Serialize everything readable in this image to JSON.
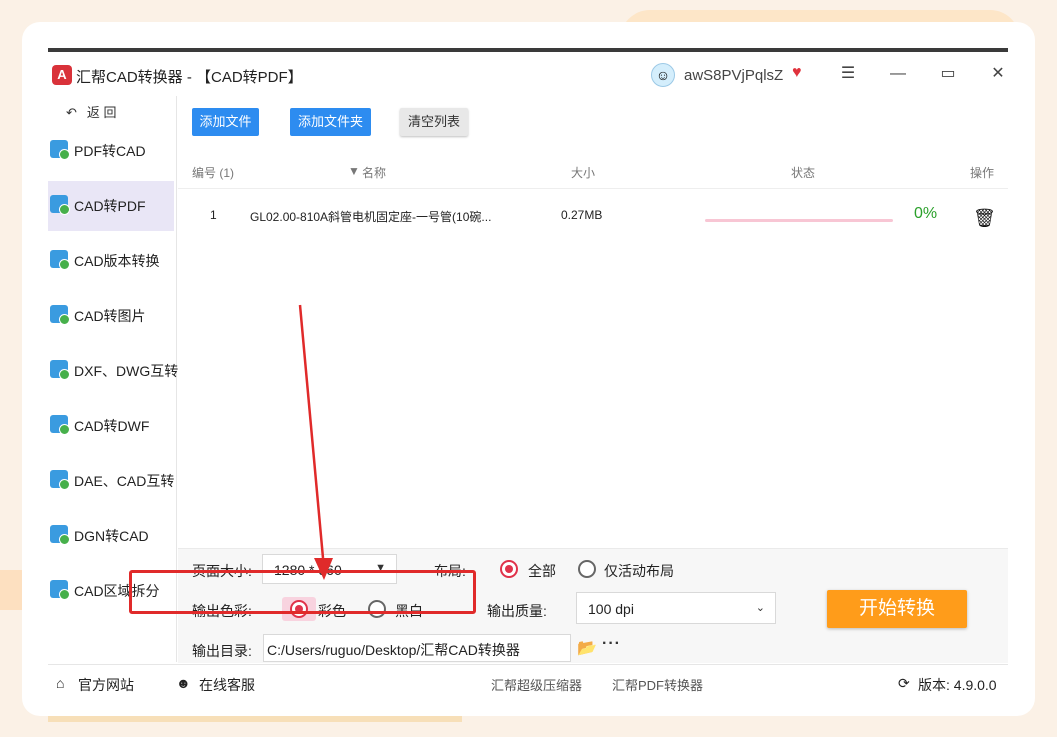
{
  "window": {
    "title": "汇帮CAD转换器 - 【CAD转PDF】",
    "username": "awS8PVjPqlsZ",
    "logo_letter": "A"
  },
  "sidebar": {
    "back_label": "返 回",
    "items": [
      {
        "label": "PDF转CAD"
      },
      {
        "label": "CAD转PDF",
        "active": true
      },
      {
        "label": "CAD版本转换"
      },
      {
        "label": "CAD转图片"
      },
      {
        "label": "DXF、DWG互转"
      },
      {
        "label": "CAD转DWF"
      },
      {
        "label": "DAE、CAD互转"
      },
      {
        "label": "DGN转CAD"
      },
      {
        "label": "CAD区域拆分"
      }
    ]
  },
  "toolbar": {
    "add_file": "添加文件",
    "add_folder": "添加文件夹",
    "clear_list": "清空列表"
  },
  "table": {
    "headers": {
      "index": "编号 (1)",
      "name": "名称",
      "size": "大小",
      "status": "状态",
      "action": "操作"
    },
    "rows": [
      {
        "index": "1",
        "name": "GL02.00-810A斜管电机固定座-一号管(10碗...",
        "size": "0.27MB",
        "progress_pct": 0,
        "status": "0%"
      }
    ]
  },
  "settings": {
    "page_size_label": "页面大小:",
    "page_size_value": "1280 * 960",
    "layout_label": "布局:",
    "layout_options": [
      "全部",
      "仅活动布局"
    ],
    "color_label": "输出色彩:",
    "color_options": [
      "彩色",
      "黑白"
    ],
    "quality_label": "输出质量:",
    "quality_value": "100 dpi",
    "output_dir_label": "输出目录:",
    "output_dir_value": "C:/Users/ruguo/Desktop/汇帮CAD转换器",
    "start_button": "开始转换"
  },
  "footer": {
    "website": "官方网站",
    "support": "在线客服",
    "link1": "汇帮超级压缩器",
    "link2": "汇帮PDF转换器",
    "version": "版本: 4.9.0.0"
  },
  "colors": {
    "accent_blue": "#2d8cf0",
    "start_orange": "#ff9c1a",
    "radio_red": "#e0324a",
    "annotation_red": "#e02a2a"
  }
}
